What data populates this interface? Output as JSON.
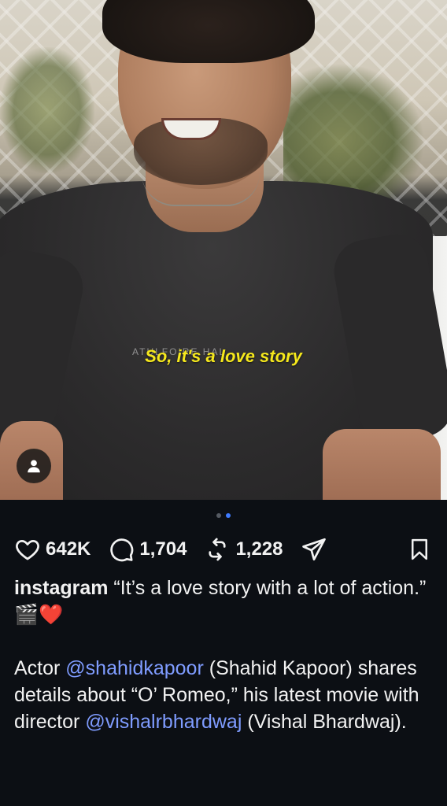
{
  "post": {
    "subtitle": "So, it's a love story",
    "shirt_print": "ATULFOIRE HAL",
    "carousel": {
      "total": 2,
      "active": 2
    }
  },
  "actions": {
    "likes": "642K",
    "comments": "1,704",
    "reposts": "1,228"
  },
  "caption": {
    "username": "instagram",
    "line1": " “It’s a love story with a lot of action.” 🎬❤️",
    "p2_a": "Actor ",
    "mention1": "@shahidkapoor",
    "p2_b": " (Shahid Kapoor) shares details about “O’ Romeo,” his latest movie with director ",
    "mention2": "@vishalrbhardwaj",
    "p2_c": " (Vishal Bhardwaj)."
  },
  "colors": {
    "background": "#0c0f14",
    "subtitle": "#f5e81c",
    "mention": "#7f9cff",
    "active_dot": "#3f7bff"
  },
  "icons": [
    "heart-icon",
    "comment-icon",
    "repost-icon",
    "share-icon",
    "bookmark-icon",
    "person-tag-icon"
  ]
}
